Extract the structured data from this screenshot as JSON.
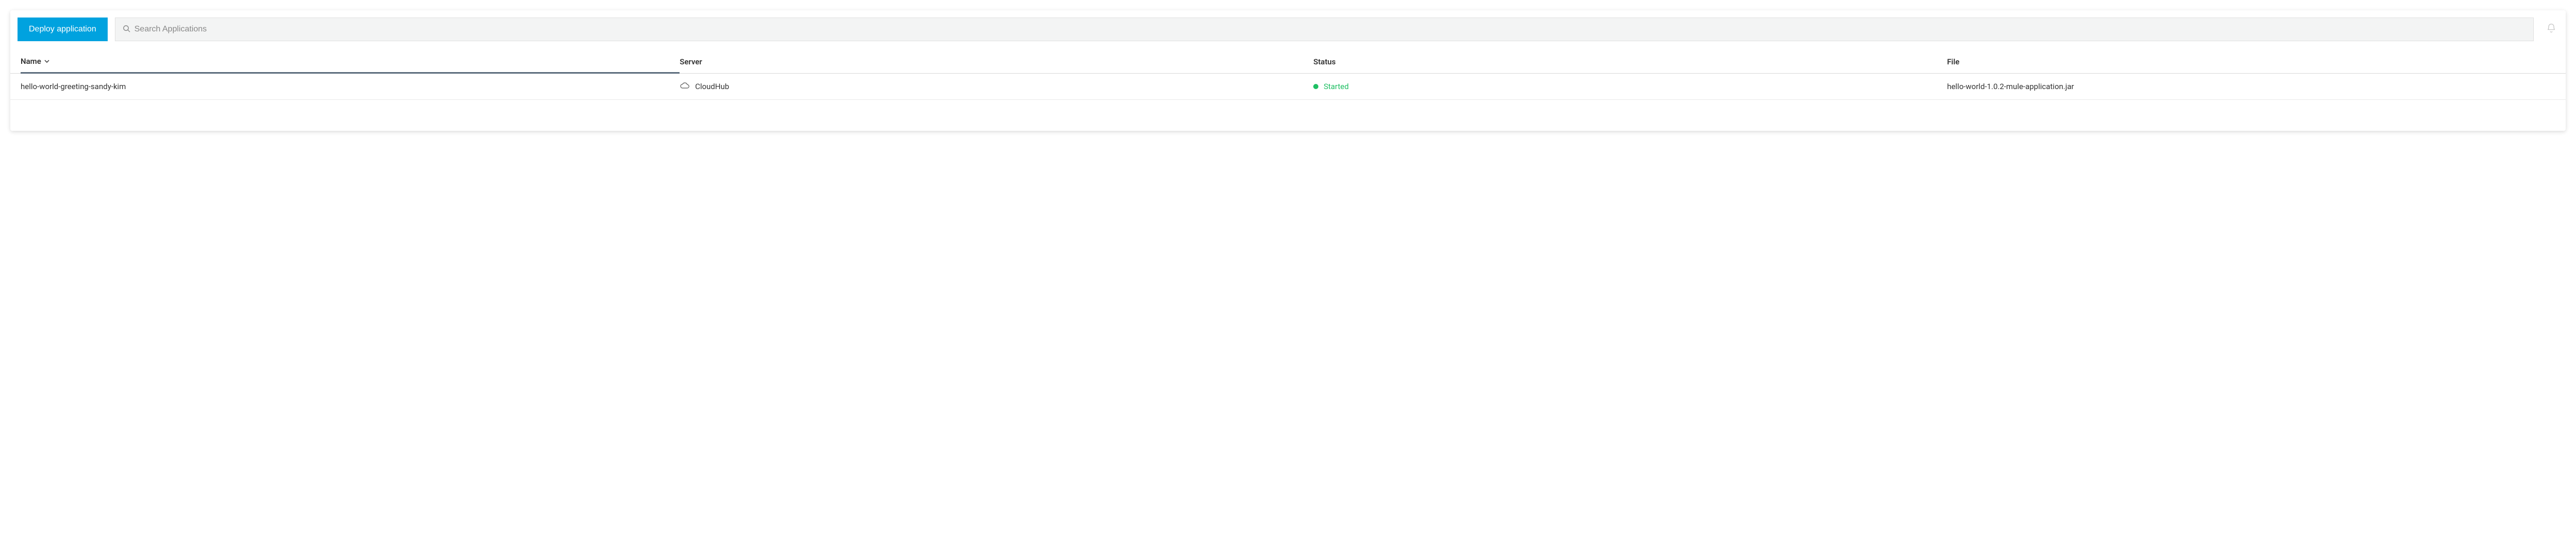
{
  "toolbar": {
    "deploy_label": "Deploy application",
    "search_placeholder": "Search Applications"
  },
  "table": {
    "headers": {
      "name": "Name",
      "server": "Server",
      "status": "Status",
      "file": "File"
    },
    "rows": [
      {
        "name": "hello-world-greeting-sandy-kim",
        "server": "CloudHub",
        "status": "Started",
        "status_color": "#1fbf63",
        "file": "hello-world-1.0.2-mule-application.jar"
      }
    ]
  }
}
